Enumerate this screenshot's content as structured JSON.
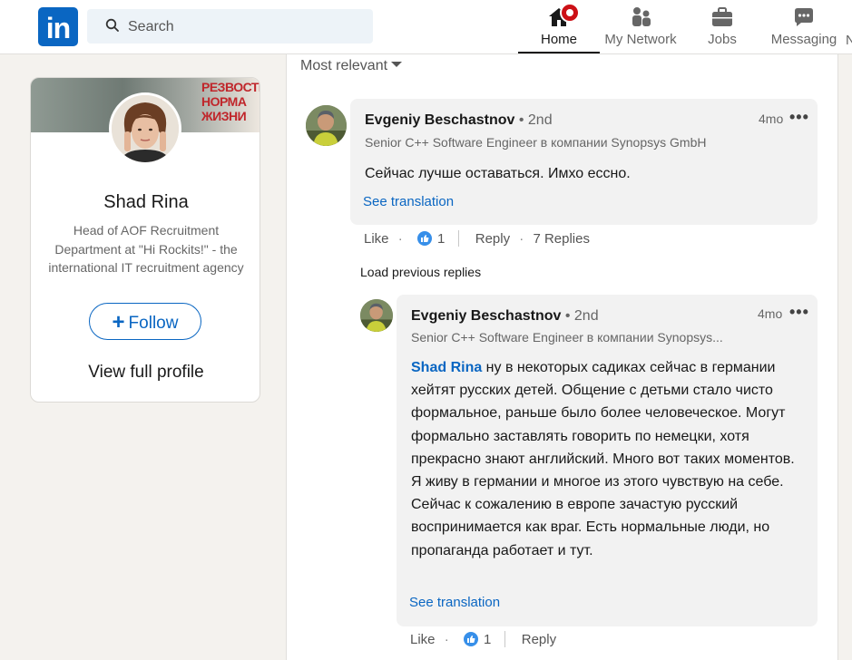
{
  "nav": {
    "logo_text": "in",
    "search_placeholder": "Search",
    "items": [
      {
        "label": "Home",
        "icon": "home-icon",
        "active": true
      },
      {
        "label": "My Network",
        "icon": "network-icon"
      },
      {
        "label": "Jobs",
        "icon": "briefcase-icon"
      },
      {
        "label": "Messaging",
        "icon": "messaging-icon"
      }
    ],
    "cut_off_label": "N"
  },
  "profile": {
    "banner_text": "РЕЗВОСТЬ НОРМА ЖИЗНИ",
    "name": "Shad Rina",
    "headline": "Head of AOF Recruitment Department at \"Hi Rockits!\" - the international IT recruitment agency",
    "follow_label": "Follow",
    "view_profile_label": "View full profile"
  },
  "feed": {
    "sort_label": "Most relevant",
    "load_previous_label": "Load previous replies",
    "comments": [
      {
        "author": "Evgeniy Beschastnov",
        "degree": "• 2nd",
        "subtitle": "Senior C++ Software Engineer в компании Synopsys GmbH",
        "time": "4mo",
        "more": "•••",
        "text": "Сейчас лучше оставаться. Имхо ессно.",
        "translate_label": "See translation",
        "like_label": "Like",
        "like_count": "1",
        "reply_label": "Reply",
        "replies_label": "7 Replies"
      },
      {
        "author": "Evgeniy Beschastnov",
        "degree": "• 2nd",
        "subtitle": "Senior C++ Software Engineer в компании Synopsys...",
        "time": "4mo",
        "more": "•••",
        "mention": "Shad Rina",
        "text": " ну в некоторых садиках сейчас в германии хейтят русских детей. Общение с детьми стало чисто формальное, раньше было более человеческое. Могут формально заставлять говорить по немецки, хотя прекрасно знают английский. Много вот таких моментов. Я живу в германии и многое из этого чувствую на себе. Сейчас к сожалению в европе зачастую русский воспринимается как враг. Есть нормальные люди, но пропаганда работает и тут.",
        "translate_label": "See translation",
        "like_label": "Like",
        "like_count": "1",
        "reply_label": "Reply"
      }
    ]
  }
}
